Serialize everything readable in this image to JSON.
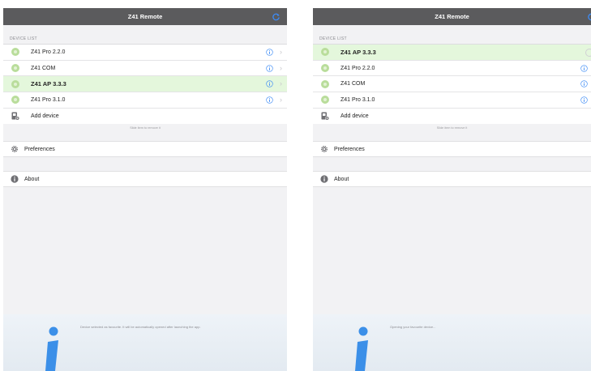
{
  "app_title": "Z41 Remote",
  "section_header": "DEVICE LIST",
  "add_device_label": "Add device",
  "swipe_hint": "Slide item to remove it",
  "preferences_label": "Preferences",
  "about_label": "About",
  "colors": {
    "navbar": "#5b5b5d",
    "accent": "#3d8bf5",
    "selected_row": "#e4f7dc",
    "status_dot": "#b9dd9b"
  },
  "left_panel": {
    "devices": [
      {
        "label": "Z41 Pro 2.2.0",
        "selected": false
      },
      {
        "label": "Z41 COM",
        "selected": false
      },
      {
        "label": "Z41 AP 3.3.3",
        "selected": true
      },
      {
        "label": "Z41 Pro 3.1.0",
        "selected": false
      }
    ],
    "footer_text": "Device selected as favourite. It will be automatically opened after launching the app."
  },
  "right_panel": {
    "devices": [
      {
        "label": "Z41 AP 3.3.3",
        "selected": true
      },
      {
        "label": "Z41 Pro 2.2.0",
        "selected": false
      },
      {
        "label": "Z41 COM",
        "selected": false
      },
      {
        "label": "Z41 Pro 3.1.0",
        "selected": false
      }
    ],
    "footer_text": "Opening your favourite device..."
  },
  "icons": {
    "refresh": "refresh-icon",
    "info": "info-icon",
    "chevron": "chevron-right-icon",
    "add": "add-device-icon",
    "gear": "gear-icon",
    "about": "about-icon",
    "logo": "info-logo-icon",
    "spinner": "loading-spinner-icon"
  }
}
